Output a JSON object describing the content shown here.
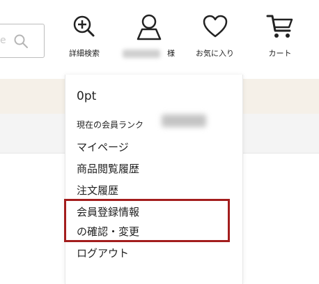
{
  "header": {
    "search": {
      "placeholder": "e"
    },
    "detail_search": {
      "label": "詳細検索",
      "icon": "magnifier-plus-icon"
    },
    "account": {
      "label": "様",
      "icon": "user-icon"
    },
    "favorites": {
      "label": "お気に入り",
      "icon": "heart-icon"
    },
    "cart": {
      "label": "カート",
      "icon": "cart-icon"
    }
  },
  "dropdown": {
    "points": "0pt",
    "rank_label": "現在の会員ランク",
    "items": [
      {
        "label": "マイページ"
      },
      {
        "label": "商品閲覧履歴"
      },
      {
        "label": "注文履歴"
      },
      {
        "label": "会員登録情報"
      },
      {
        "label": "の確認・変更"
      },
      {
        "label": "ログアウト"
      }
    ],
    "highlight_color": "#a31d1d"
  },
  "colors": {
    "band_beige": "#f5f0e8",
    "band_gray": "#f4f4f4"
  }
}
